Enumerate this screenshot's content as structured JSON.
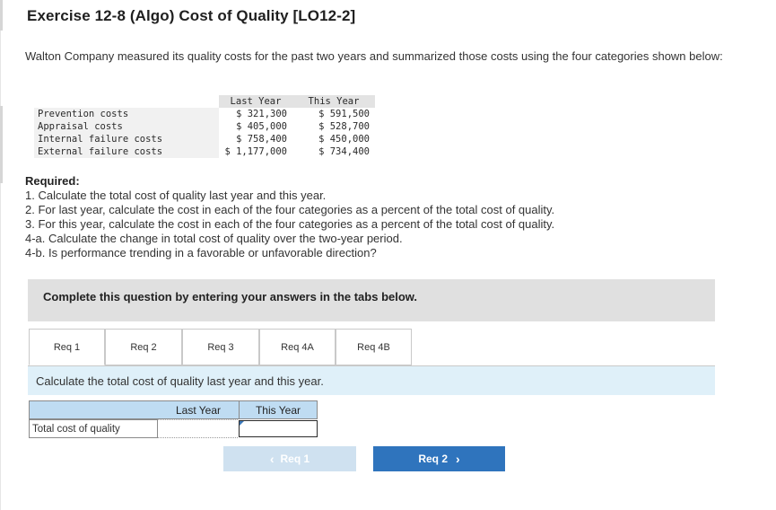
{
  "title": "Exercise 12-8 (Algo) Cost of Quality [LO12-2]",
  "intro": "Walton Company measured its quality costs for the past two years and summarized those costs using the four categories shown below:",
  "cost_table": {
    "headers": [
      "Last Year",
      "This Year"
    ],
    "rows": [
      {
        "label": "Prevention costs",
        "last": "$ 321,300",
        "this": "$ 591,500"
      },
      {
        "label": "Appraisal costs",
        "last": "$ 405,000",
        "this": "$ 528,700"
      },
      {
        "label": "Internal failure costs",
        "last": "$ 758,400",
        "this": "$ 450,000"
      },
      {
        "label": "External failure costs",
        "last": "$ 1,177,000",
        "this": "$ 734,400"
      }
    ]
  },
  "required": {
    "heading": "Required:",
    "items": [
      "1. Calculate the total cost of quality last year and this year.",
      "2. For last year, calculate the cost in each of the four categories as a percent of the total cost of quality.",
      "3. For this year, calculate the cost in each of the four categories as a percent of the total cost of quality.",
      "4-a. Calculate the change in total cost of quality over the two-year period.",
      "4-b. Is performance trending in a favorable or unfavorable direction?"
    ]
  },
  "banner": "Complete this question by entering your answers in the tabs below.",
  "tabs": [
    {
      "label": "Req 1",
      "active": true
    },
    {
      "label": "Req 2",
      "active": false
    },
    {
      "label": "Req 3",
      "active": false
    },
    {
      "label": "Req 4A",
      "active": false
    },
    {
      "label": "Req 4B",
      "active": false
    }
  ],
  "instruction": "Calculate the total cost of quality last year and this year.",
  "answer_table": {
    "columns": [
      "Last Year",
      "This Year"
    ],
    "row_label": "Total cost of quality",
    "last_value": "",
    "this_value": ""
  },
  "nav": {
    "prev_label": "Req 1",
    "next_label": "Req 2",
    "prev_icon": "chevron-left-icon",
    "next_icon": "chevron-right-icon"
  },
  "colors": {
    "accent": "#2f74bd",
    "accent_disabled": "#cfe1f0",
    "instruction_bg": "#dff0f9",
    "answer_header_bg": "#bfdcf2"
  }
}
